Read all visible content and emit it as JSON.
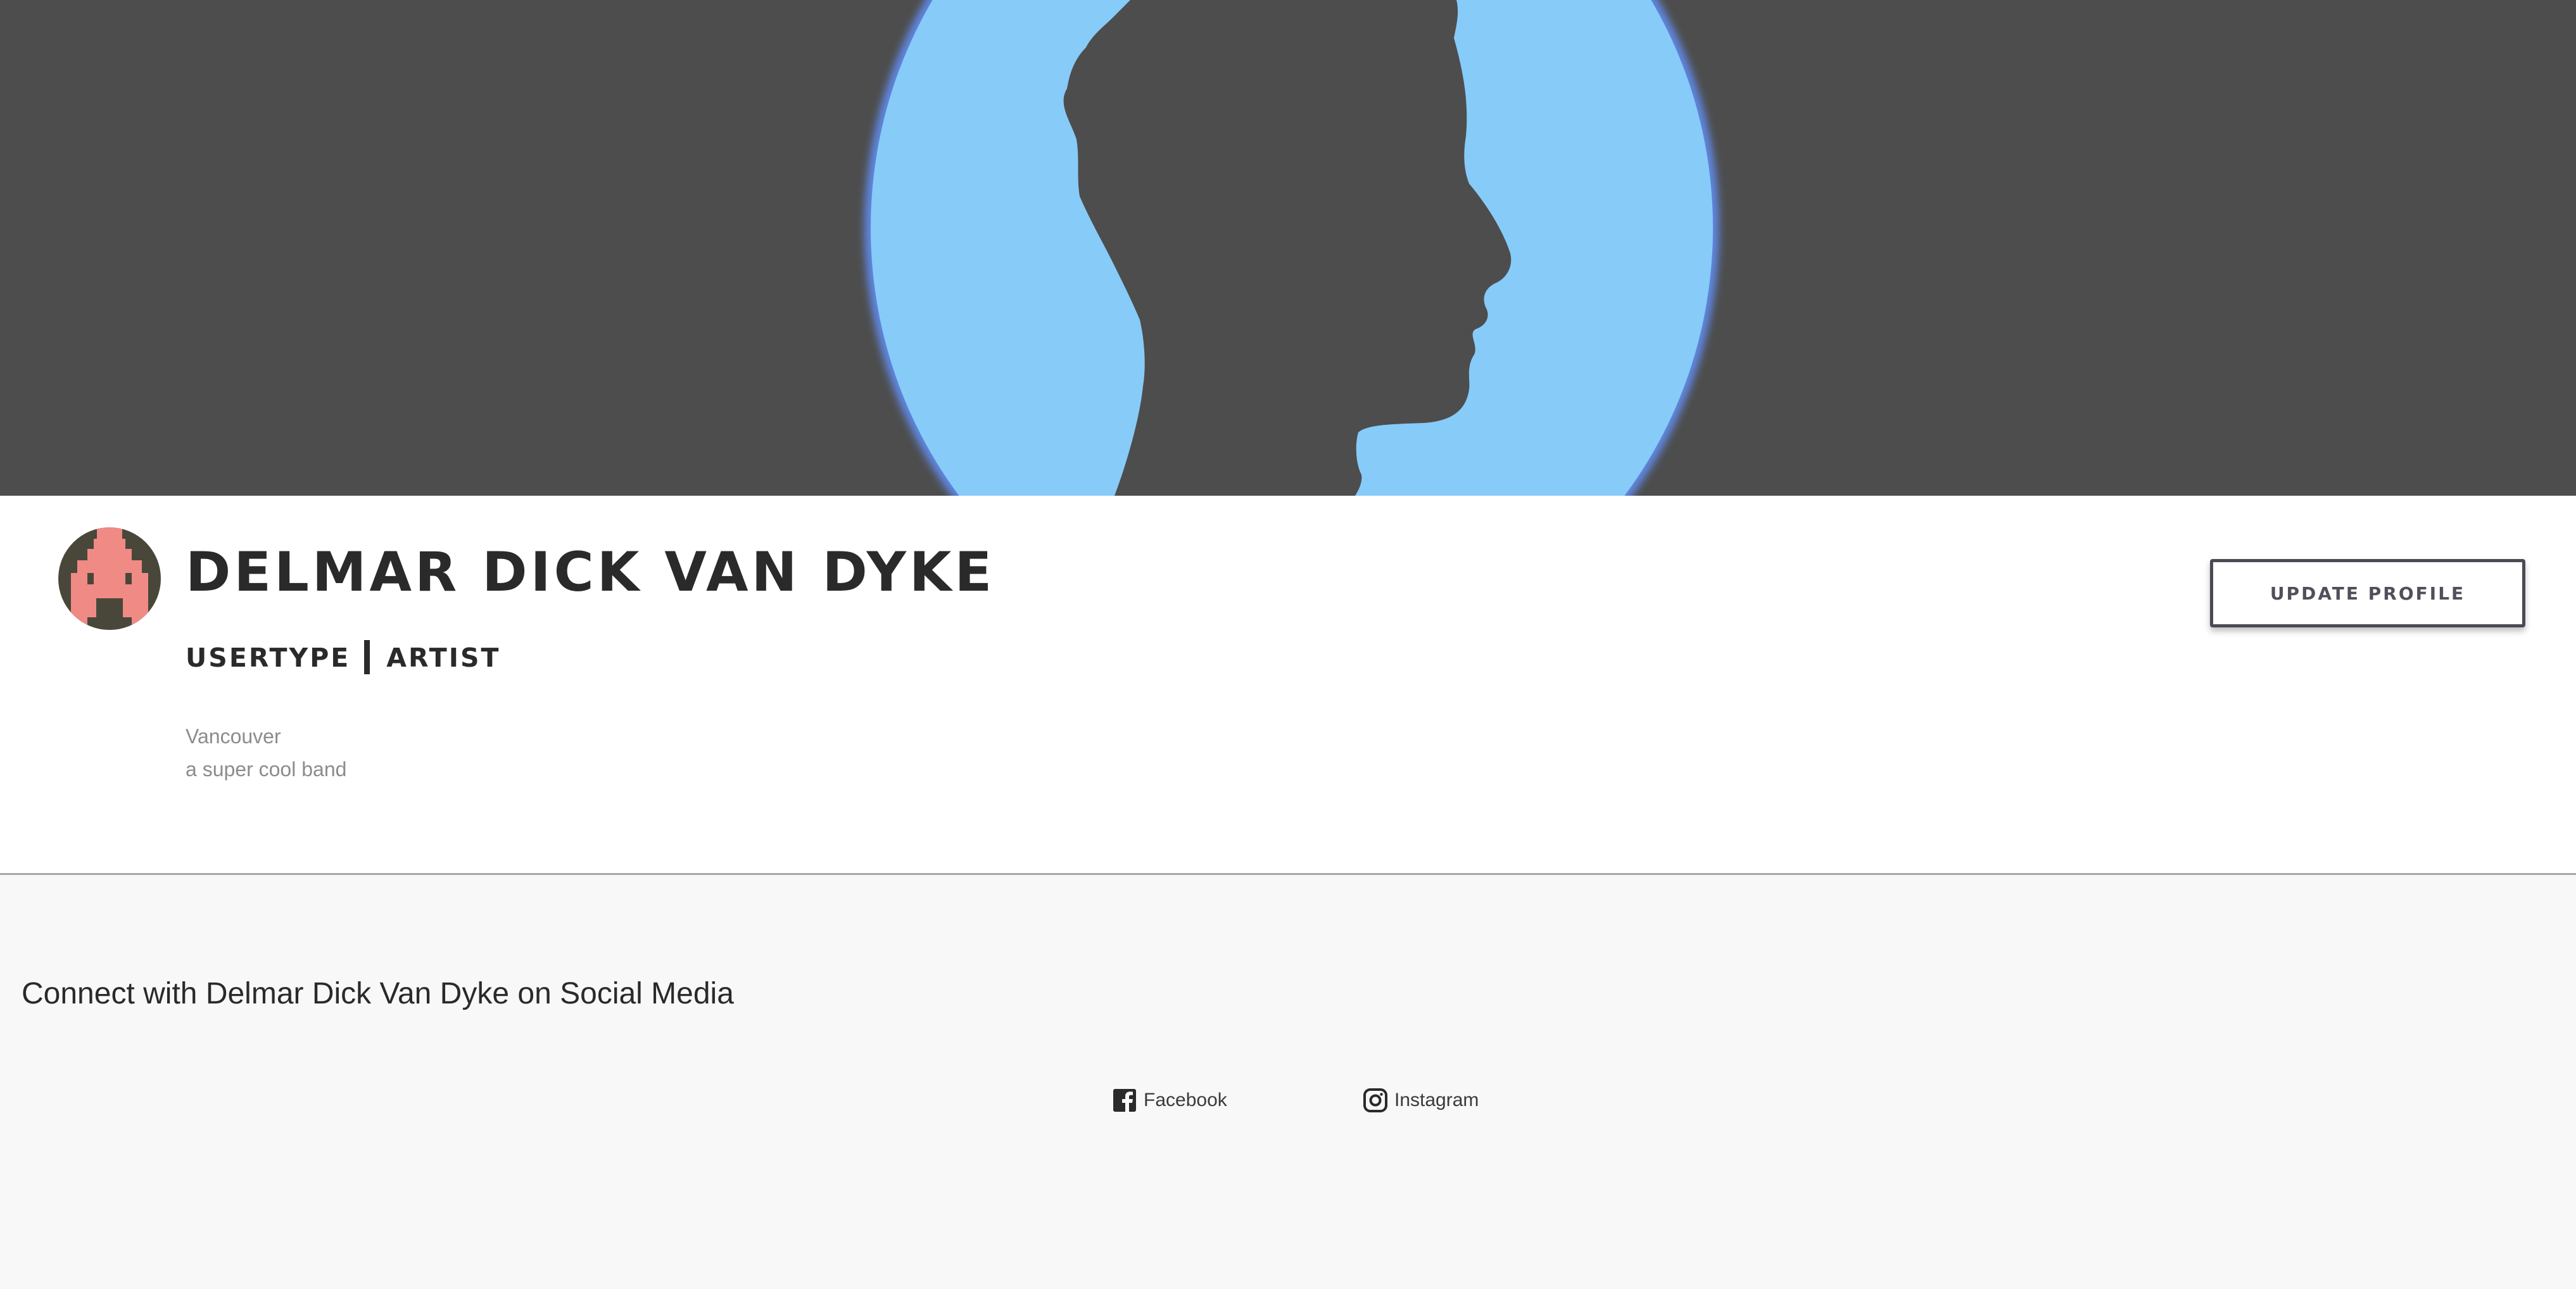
{
  "profile": {
    "name": "DELMAR DICK VAN DYKE",
    "usertype_label": "USERTYPE",
    "usertype_value": "ARTIST",
    "location": "Vancouver",
    "bio": "a super cool band",
    "update_button_label": "UPDATE PROFILE"
  },
  "social": {
    "heading": "Connect with Delmar Dick Van Dyke on Social Media",
    "links": [
      {
        "label": "Facebook",
        "icon": "facebook-icon"
      },
      {
        "label": "Instagram",
        "icon": "instagram-icon"
      }
    ]
  },
  "colors": {
    "banner_background": "#4d4d4d",
    "banner_circle": "#87cbf8",
    "silhouette": "#4d4d4d",
    "avatar_background": "#48473a",
    "avatar_figure": "#ef8a84",
    "text_dark": "#2a2a2a",
    "text_muted": "#8c8c8c",
    "social_background": "#f8f8f8"
  }
}
